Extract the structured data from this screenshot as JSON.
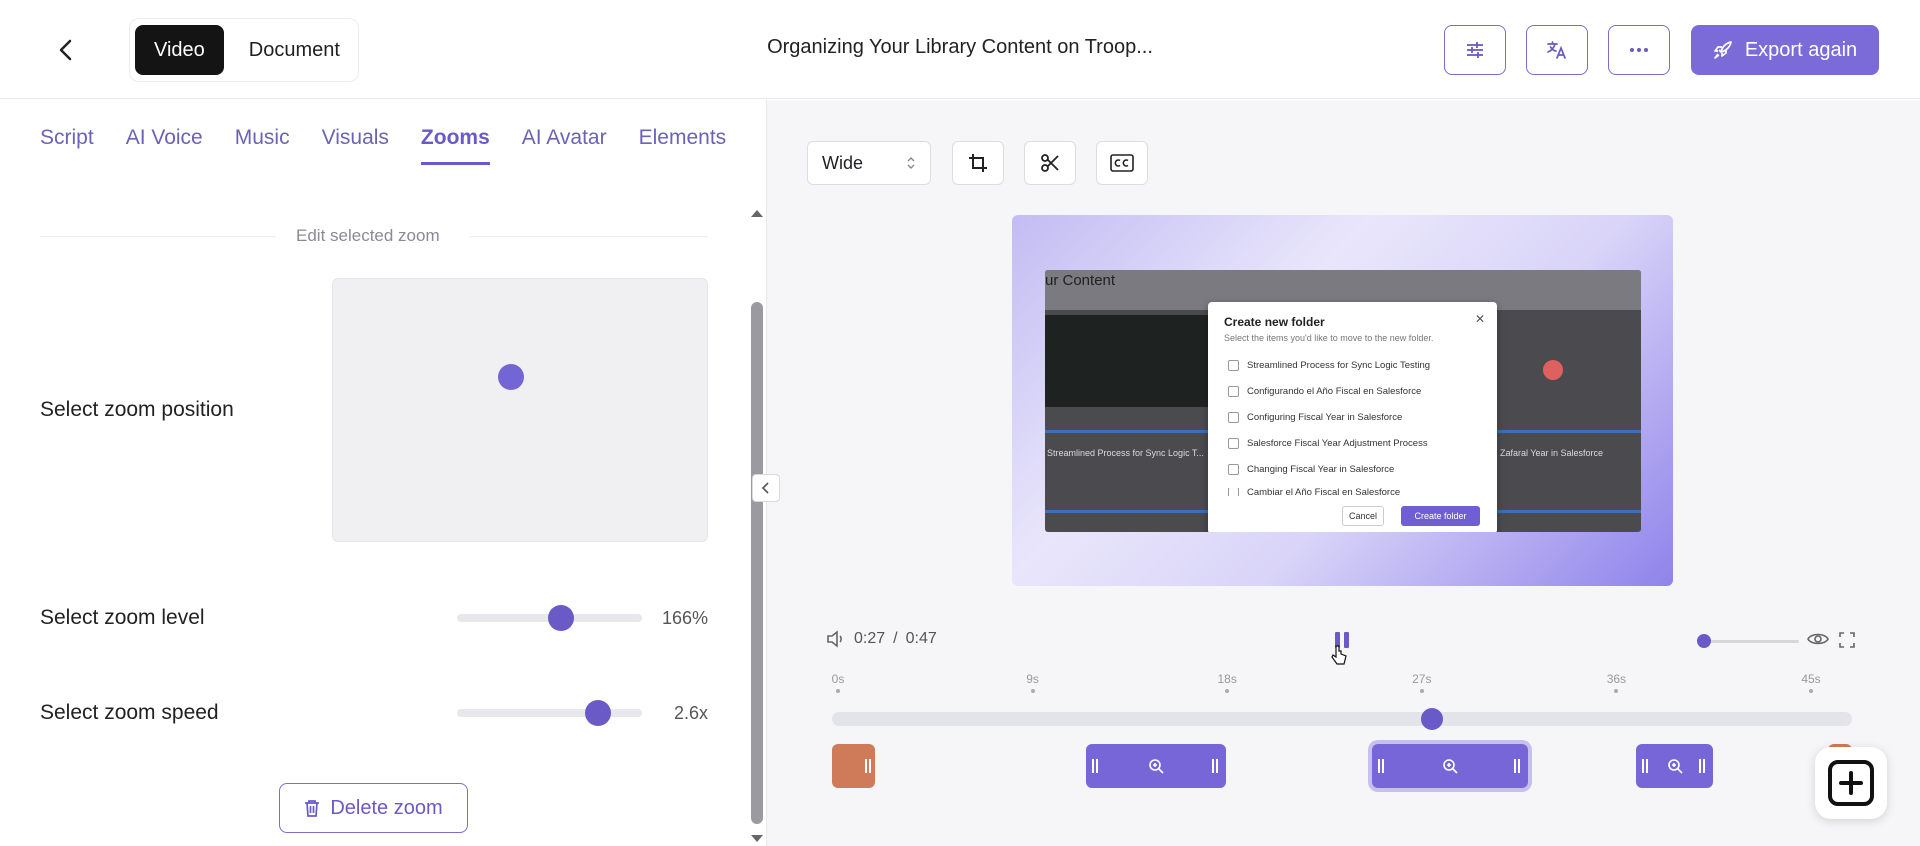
{
  "header": {
    "mode_tabs": [
      {
        "label": "Video",
        "active": true
      },
      {
        "label": "Document",
        "active": false
      }
    ],
    "title": "Organizing Your Library Content on Troop...",
    "export_label": "Export again"
  },
  "left": {
    "tabs": [
      {
        "label": "Script"
      },
      {
        "label": "AI Voice"
      },
      {
        "label": "Music"
      },
      {
        "label": "Visuals"
      },
      {
        "label": "Zooms",
        "active": true
      },
      {
        "label": "AI Avatar"
      },
      {
        "label": "Elements"
      }
    ],
    "section_label": "Edit selected zoom",
    "position_label": "Select zoom position",
    "zoom_level_label": "Select zoom level",
    "zoom_level_value": "166%",
    "zoom_level_fraction": 0.56,
    "zoom_speed_label": "Select zoom speed",
    "zoom_speed_value": "2.6x",
    "zoom_speed_fraction": 0.76,
    "delete_label": "Delete zoom"
  },
  "right": {
    "aspect_select": "Wide",
    "preview": {
      "background_title": "ur Content",
      "dialog_title": "Create new folder",
      "dialog_subtitle": "Select the items you'd like to move to the new folder.",
      "items": [
        "Streamlined Process for Sync Logic Testing",
        "Configurando el Año Fiscal en Salesforce",
        "Configuring Fiscal Year in Salesforce",
        "Salesforce Fiscal Year Adjustment Process",
        "Changing Fiscal Year in Salesforce",
        "Cambiar el Año Fiscal en Salesforce"
      ],
      "cancel_label": "Cancel",
      "create_label": "Create folder",
      "bg_card_left": "Streamlined Process for Sync Logic T...",
      "bg_card_right": "Zafaral Year in Salesforce"
    },
    "player": {
      "current_time": "0:27",
      "separator": "/",
      "duration": "0:47",
      "progress_fraction": 0.588,
      "volume_fraction": 0.0
    },
    "ruler": [
      "0s",
      "9s",
      "18s",
      "27s",
      "36s",
      "45s"
    ]
  },
  "colors": {
    "accent": "#6a5ac7",
    "export": "#7b6bd8",
    "clip_orange": "#cf7a58"
  }
}
